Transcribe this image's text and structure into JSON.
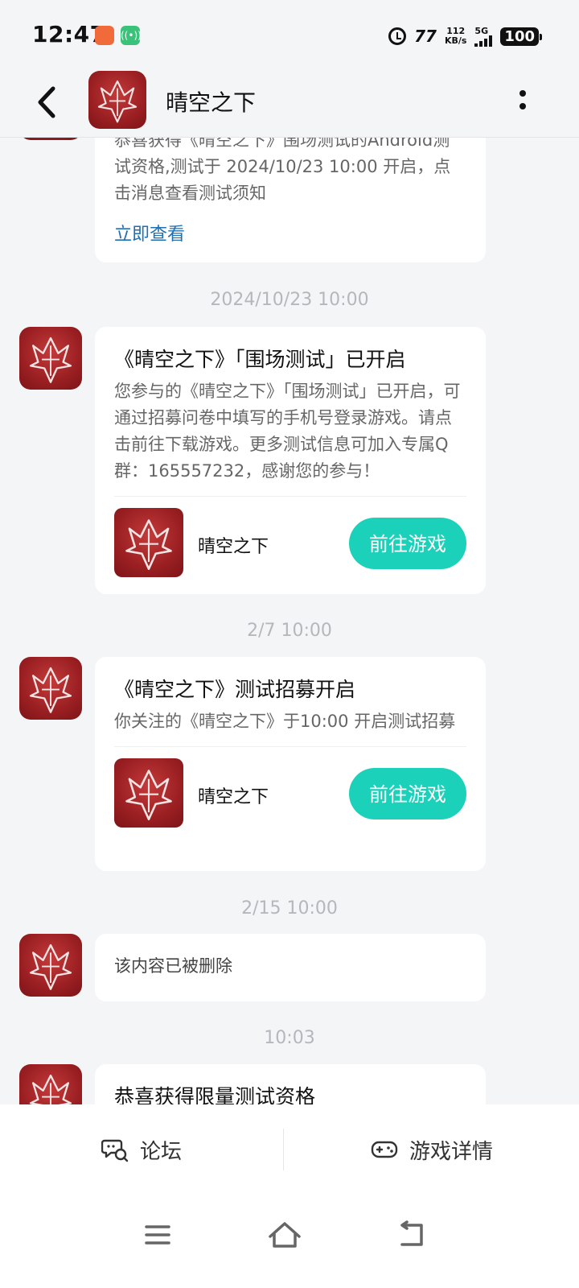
{
  "status_bar": {
    "time": "12:47",
    "app_badge_text": "((•))",
    "nfc_text": "77",
    "speed_value": "112",
    "speed_unit": "KB/s",
    "network": "5G",
    "battery": "100"
  },
  "header": {
    "title": "晴空之下"
  },
  "messages": [
    {
      "body": "恭喜获得《晴空之下》围场测试的Android测试资格,测试于 2024/10/23 10:00 开启，点击消息查看测试须知",
      "link": "立即查看"
    },
    {
      "timestamp": "2024/10/23  10:00",
      "title": "《晴空之下》「围场测试」已开启",
      "body": "您参与的《晴空之下》「围场测试」已开启，可通过招募问卷中填写的手机号登录游戏。请点击前往下载游戏。更多测试信息可加入专属Q群：165557232，感谢您的参与！",
      "game_name": "晴空之下",
      "button": "前往游戏"
    },
    {
      "timestamp": "2/7  10:00",
      "title": "《晴空之下》测试招募开启",
      "body": "你关注的《晴空之下》于10:00 开启测试招募",
      "game_name": "晴空之下",
      "button": "前往游戏"
    },
    {
      "timestamp": "2/15  10:00",
      "body": "该内容已被删除"
    },
    {
      "timestamp": "10:03",
      "title": "恭喜获得限量测试资格"
    }
  ],
  "tabbar": {
    "forum": "论坛",
    "game_detail": "游戏详情"
  },
  "colors": {
    "accent": "#1cd1b9",
    "link": "#1f6fb3",
    "logo_red": "#9a1f22"
  }
}
